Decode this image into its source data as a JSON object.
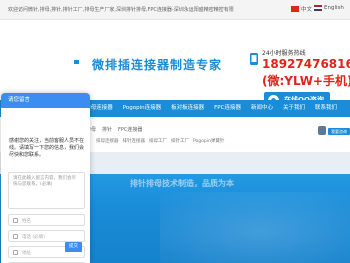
{
  "topbar": {
    "welcome": "欢迎访问微针,排母,排针,排针工厂,排母生产厂家,深圳排针排母,FPC连接器-深圳永运阳盛精密精密有限",
    "lang_cn": "中文",
    "lang_en": "English"
  },
  "header": {
    "slogan": "微排插连接器制造专家",
    "hotline_label": "24小时服务热线",
    "phone": "18927476816",
    "wechat": "(微:YLW+手机)",
    "qq_label": "在线QQ咨询",
    "qq_sub": "CONTACT US QQ ONLINE"
  },
  "nav": {
    "items": [
      "排母连接器",
      "Pogopin连接器",
      "板对板连接器",
      "FPC连接器",
      "新闻中心",
      "关于我们",
      "联系我们"
    ]
  },
  "breadcrumbs": [
    "排母",
    "排针",
    "FPC连接器"
  ],
  "subcrumbs": [
    "排母连接器",
    "排针连接器",
    "排母工厂",
    "排针工厂",
    "Pogopin弹簧针"
  ],
  "consult_label": "我要咨询",
  "banner": {
    "text": "排针排母技术制造，品质为本"
  },
  "chat": {
    "title": "请您留言",
    "intro": "感谢您的关注，当前客服人员不在线。请填写一下您的信息，我们会尽快和您联系。",
    "textarea_placeholder": "请在此输入留言内容，我们会尽快与您联系。(必填)",
    "fields": [
      "姓名",
      "电话 (必填)",
      "地址",
      "邮箱"
    ],
    "submit": "提交"
  },
  "colors": {
    "brand_blue": "#1a8cd8",
    "phone_red": "#e2231a",
    "chat_blue": "#3d8df0"
  }
}
